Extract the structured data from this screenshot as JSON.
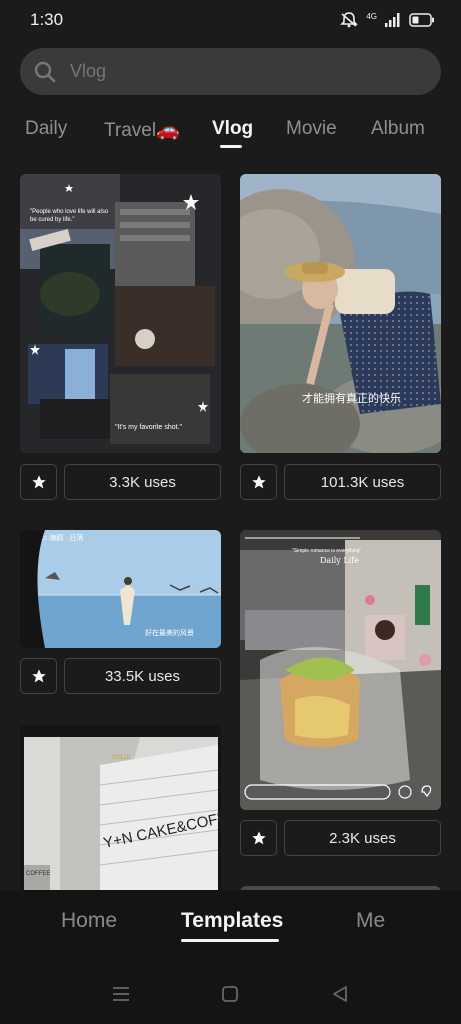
{
  "status": {
    "time": "1:30",
    "network": "4G"
  },
  "search": {
    "placeholder": "Vlog"
  },
  "tabs": [
    {
      "label": "Daily",
      "active": false
    },
    {
      "label": "Travel🚗",
      "active": false
    },
    {
      "label": "Vlog",
      "active": true
    },
    {
      "label": "Movie",
      "active": false
    },
    {
      "label": "Album",
      "active": false
    }
  ],
  "cards": {
    "card1": {
      "quote1": "\"People who love life will also be cured by life.\"",
      "quote2": "\"It's my favorite shot.\"",
      "uses": "3.3K uses"
    },
    "card2": {
      "caption": "才能拥有真正的快乐",
      "uses": "101.3K uses"
    },
    "card3": {
      "top_text": "♫ 海鸥 · 日落",
      "caption": "好在最美的风景",
      "uses": "33.5K uses"
    },
    "card4": {
      "subtitle": "\"Simple romance is everything\"",
      "title": "Daily Life",
      "uses": "2.3K uses"
    },
    "card5": {
      "sign": "Y+N CAKE&COFFEE",
      "brand": "VOLDI",
      "coffee_sign": "COFFEE"
    }
  },
  "nav": [
    {
      "label": "Home",
      "active": false
    },
    {
      "label": "Templates",
      "active": true
    },
    {
      "label": "Me",
      "active": false
    }
  ],
  "colors": {
    "background": "#1b1b1b",
    "search_bg": "#3a3a3a",
    "active": "#f4f4f4",
    "inactive": "#8f8f8f"
  },
  "icons": [
    "mute-icon",
    "signal-icon",
    "battery-icon",
    "search-icon",
    "star-icon",
    "menu-icon",
    "home-square-icon",
    "back-triangle-icon"
  ]
}
